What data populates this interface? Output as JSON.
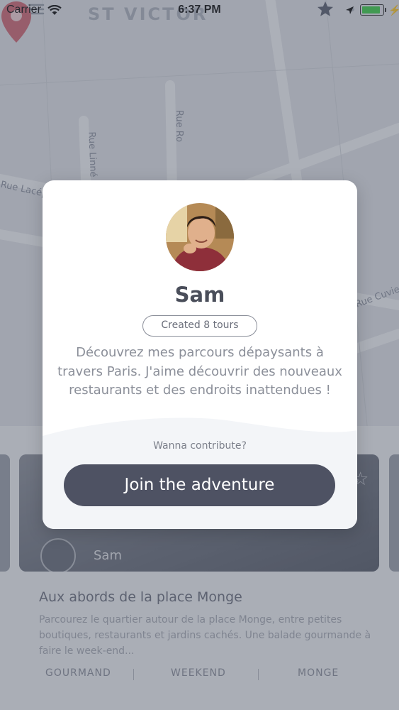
{
  "status_bar": {
    "carrier": "Carrier",
    "time": "6:37 PM",
    "icons": [
      "wifi-icon",
      "location-arrow-icon",
      "battery-icon",
      "charging-bolt-icon"
    ],
    "battery_color": "#3fd34a",
    "battery_level": 0.9
  },
  "map": {
    "district_label": "ST VICTOR",
    "street_labels": [
      "Rue Lacépède",
      "Rue Linné",
      "Rue Ro",
      "Rue Cuvier"
    ],
    "pin_color": "#c94a5a"
  },
  "tour_card": {
    "author": "Sam",
    "title": "Aux abords de la place Monge",
    "description": "Parcourez le quartier autour de la place Monge, entre petites boutiques, restaurants et jardins cachés. Une balade gourmande à faire le week-end...",
    "tags": [
      "GOURMAND",
      "WEEKEND",
      "MONGE"
    ]
  },
  "profile_modal": {
    "name": "Sam",
    "tours_badge": "Created 8 tours",
    "bio": "Découvrez mes parcours dépaysants à travers Paris. J'aime découvrir des nouveaux restaurants et des endroits inattendues !",
    "contribute_prompt": "Wanna contribute?",
    "join_button": "Join the adventure"
  },
  "colors": {
    "overlay": "rgba(70,76,92,0.42)",
    "button": "#4e5263",
    "name_text": "#4a4e5a",
    "body_text": "#8b8f99"
  }
}
